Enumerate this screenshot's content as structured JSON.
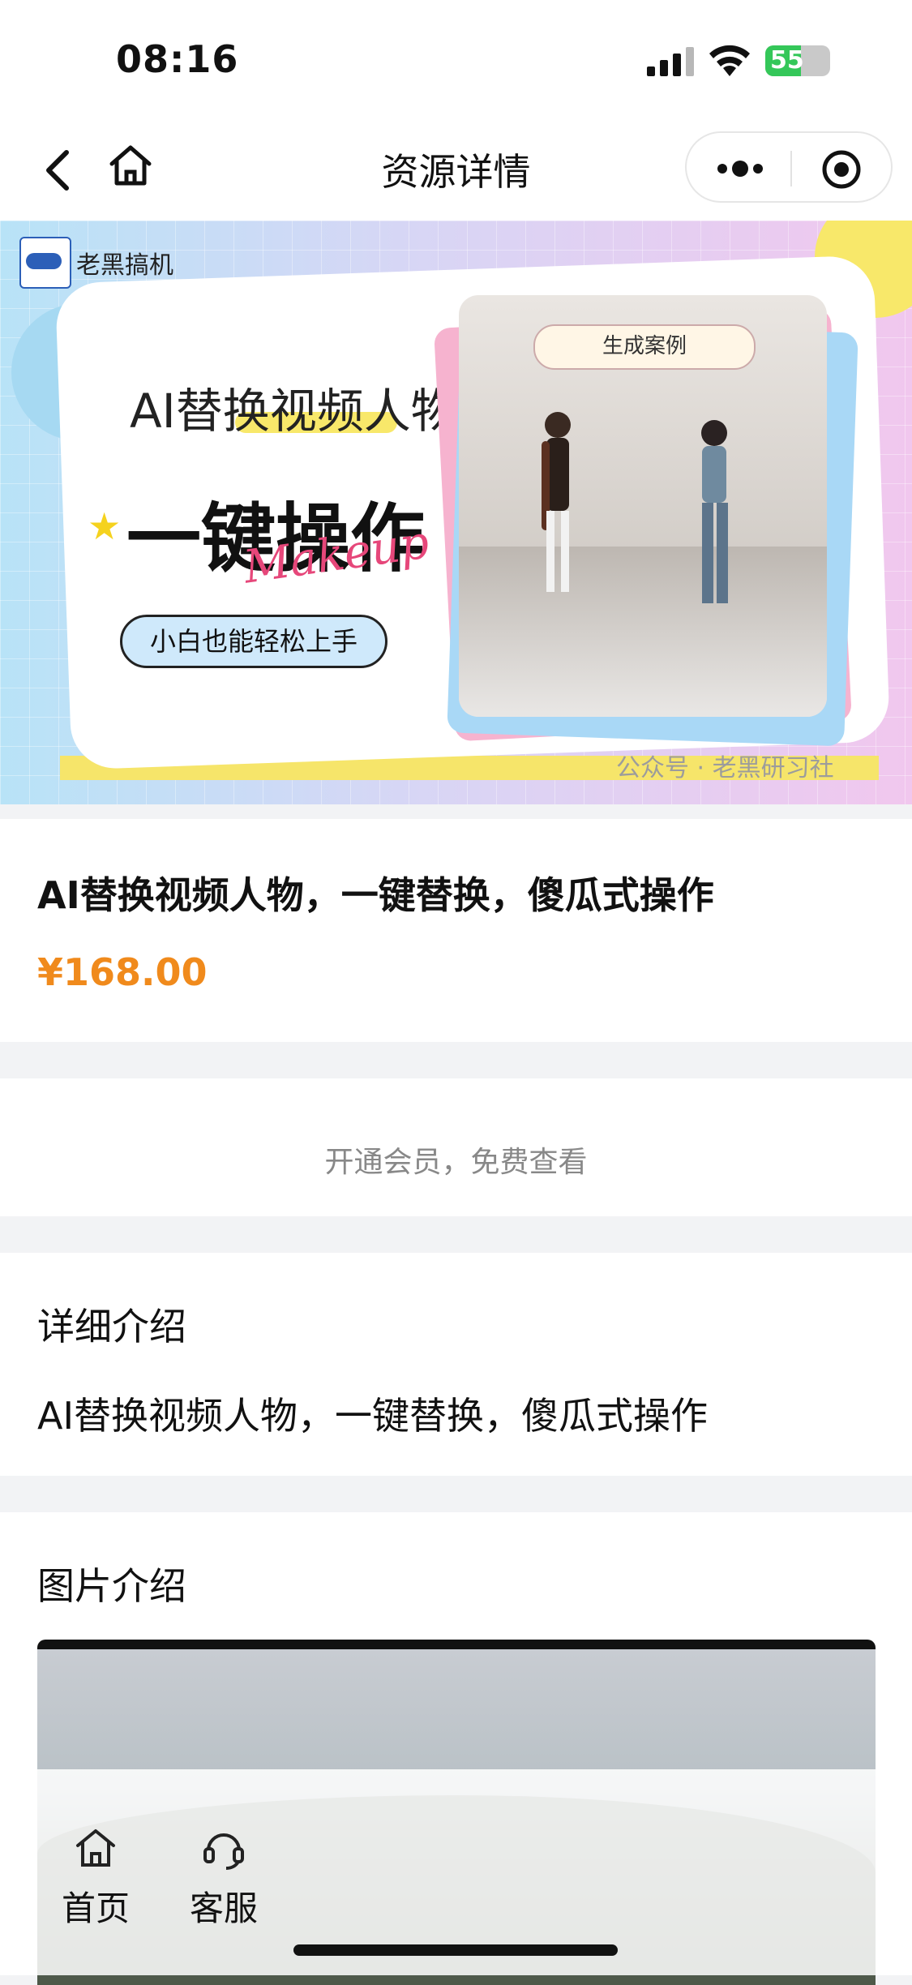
{
  "status_bar": {
    "time": "08:16",
    "battery": "55",
    "battery_level": 0.55
  },
  "nav": {
    "title": "资源详情"
  },
  "banner": {
    "brand": "老黑搞机",
    "heading_small": "AI替换视频人物",
    "heading_big": "一键操作",
    "script_text": "Makeup",
    "pill_text": "小白也能轻松上手",
    "photo_label": "生成案例",
    "watermark": "公众号 · 老黑研习社"
  },
  "product": {
    "name": "AI替换视频人物，一键替换，傻瓜式操作",
    "price": "¥168.00"
  },
  "member": {
    "text": "开通会员，免费查看"
  },
  "detail": {
    "heading": "详细介绍",
    "body": "AI替换视频人物，一键替换，傻瓜式操作"
  },
  "images": {
    "heading": "图片介绍"
  },
  "tabbar": {
    "home": "首页",
    "service": "客服"
  },
  "colors": {
    "price": "#f08a1c",
    "battery": "#34c759"
  }
}
